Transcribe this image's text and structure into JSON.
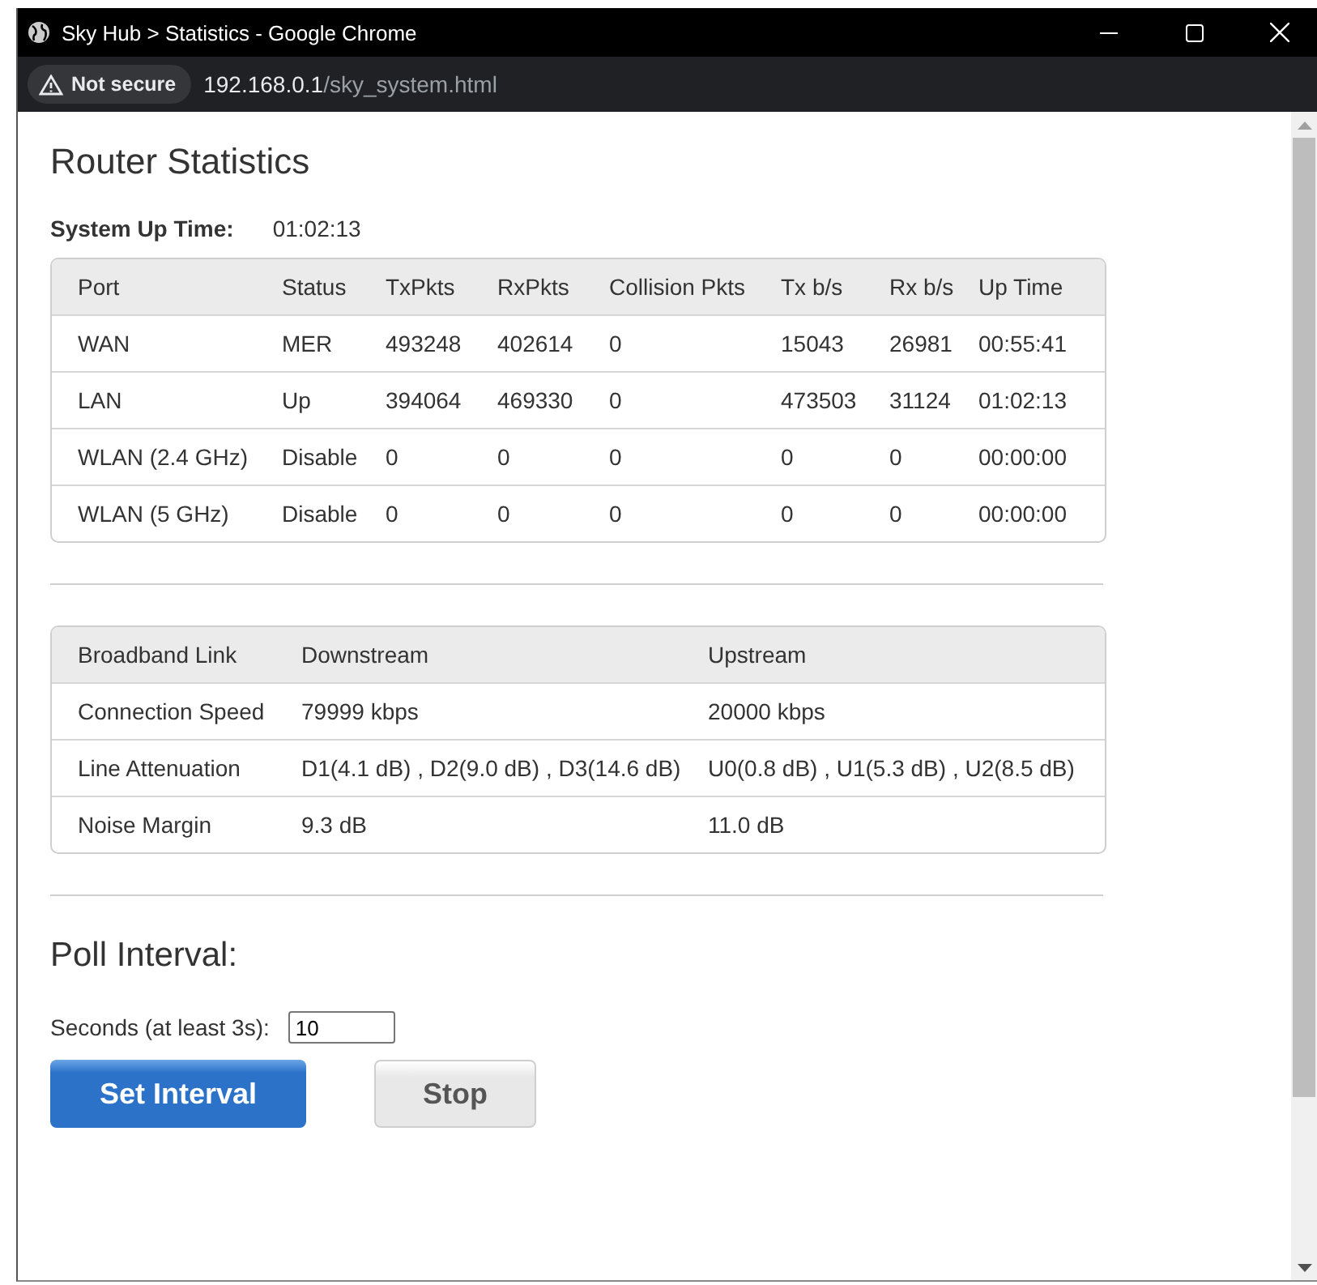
{
  "window": {
    "title": "Sky Hub > Statistics - Google Chrome"
  },
  "address_bar": {
    "security": "Not secure",
    "host": "192.168.0.1",
    "path": "/sky_system.html"
  },
  "page": {
    "title": "Router Statistics",
    "uptime_label": "System Up Time:",
    "uptime_value": "01:02:13"
  },
  "port_table": {
    "columns": [
      "Port",
      "Status",
      "TxPkts",
      "RxPkts",
      "Collision Pkts",
      "Tx b/s",
      "Rx b/s",
      "Up Time"
    ],
    "rows": [
      [
        "WAN",
        "MER",
        "493248",
        "402614",
        "0",
        "15043",
        "26981",
        "00:55:41"
      ],
      [
        "LAN",
        "Up",
        "394064",
        "469330",
        "0",
        "473503",
        "31124",
        "01:02:13"
      ],
      [
        "WLAN (2.4 GHz)",
        "Disable",
        "0",
        "0",
        "0",
        "0",
        "0",
        "00:00:00"
      ],
      [
        "WLAN (5 GHz)",
        "Disable",
        "0",
        "0",
        "0",
        "0",
        "0",
        "00:00:00"
      ]
    ]
  },
  "link_table": {
    "columns": [
      "Broadband Link",
      "Downstream",
      "Upstream"
    ],
    "rows": [
      [
        "Connection Speed",
        "79999 kbps",
        "20000 kbps"
      ],
      [
        "Line Attenuation",
        "D1(4.1 dB) , D2(9.0 dB) , D3(14.6 dB)",
        "U0(0.8 dB) , U1(5.3 dB) , U2(8.5 dB)"
      ],
      [
        "Noise Margin",
        "9.3 dB",
        "11.0 dB"
      ]
    ]
  },
  "poll": {
    "heading": "Poll Interval:",
    "label": "Seconds (at least 3s):",
    "value": "10"
  },
  "buttons": [
    {
      "label": "Set Interval",
      "kind": "primary"
    },
    {
      "label": "Stop",
      "kind": "secondary"
    }
  ]
}
